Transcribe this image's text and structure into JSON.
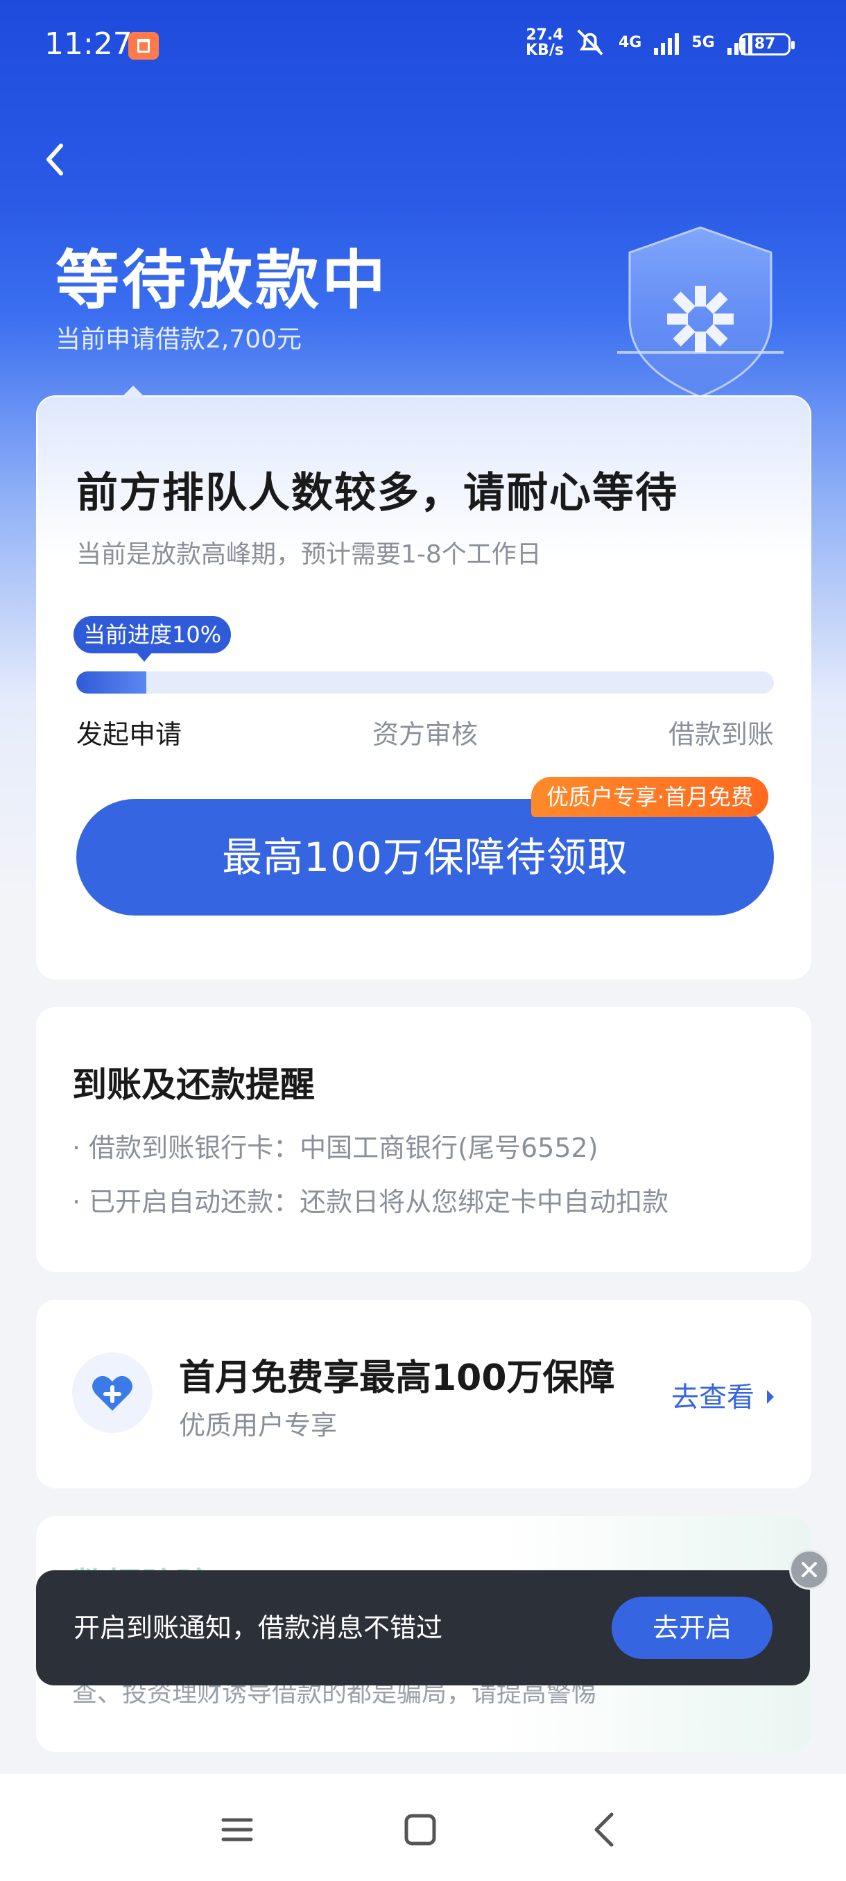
{
  "status_bar": {
    "time": "11:27",
    "net_speed_value": "27.4",
    "net_speed_unit": "KB/s",
    "net_4g": "4G",
    "net_5g": "5G",
    "battery": "87"
  },
  "header": {
    "title": "等待放款中",
    "subtitle": "当前申请借款2,700元"
  },
  "progress_card": {
    "title": "前方排队人数较多，请耐心等待",
    "description": "当前是放款高峰期，预计需要1-8个工作日",
    "progress_label": "当前进度10%",
    "progress_fraction": 0.1,
    "steps": [
      "发起申请",
      "资方审核",
      "借款到账"
    ],
    "cta_label": "最高100万保障待领取",
    "cta_badge": "优质户专享·首月免费"
  },
  "reminder_card": {
    "title": "到账及还款提醒",
    "items": [
      "· 借款到账银行卡：中国工商银行(尾号6552)",
      "· 已开启自动还款：还款日将从您绑定卡中自动扣款"
    ]
  },
  "insurance_card": {
    "title": "首月免费享最高100万保障",
    "subtitle": "优质用户专享",
    "link_label": "去查看"
  },
  "hidden_card": {
    "title": "数据防骗",
    "text": "查、投资理财诱导借款的都是骗局，请提高警惕"
  },
  "toast": {
    "message": "开启到账通知，借款消息不错过",
    "button_label": "去开启"
  },
  "colors": {
    "primary": "#3565e0",
    "header_blue": "#1e4bdc",
    "badge_orange": "#ff7a2a",
    "toast_bg": "#2c3038"
  }
}
